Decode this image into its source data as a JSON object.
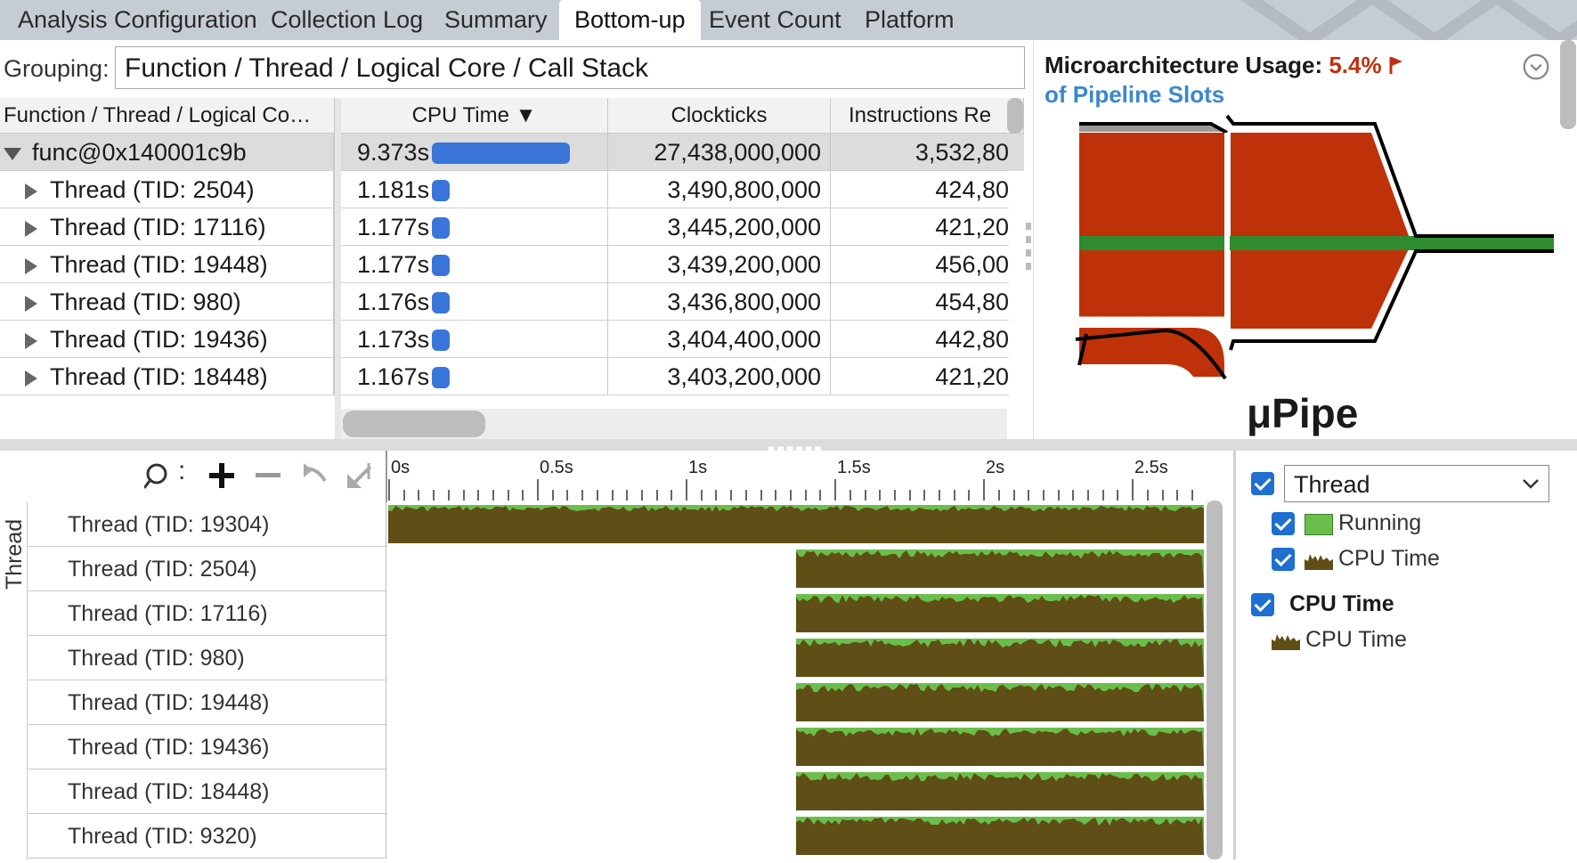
{
  "tabs": [
    {
      "label": "Analysis Configuration",
      "active": false
    },
    {
      "label": "Collection Log",
      "active": false
    },
    {
      "label": "Summary",
      "active": false
    },
    {
      "label": "Bottom-up",
      "active": true
    },
    {
      "label": "Event Count",
      "active": false
    },
    {
      "label": "Platform",
      "active": false
    }
  ],
  "grouping": {
    "label": "Grouping:",
    "value": "Function / Thread / Logical Core / Call Stack"
  },
  "grid": {
    "columns": [
      "Function / Thread / Logical Co…",
      "CPU Time ▼",
      "Clockticks",
      "Instructions Re"
    ],
    "max_cpu_time": 9.373,
    "rows": [
      {
        "name": "func@0x140001c9b",
        "cpu": "9.373s",
        "cpu_s": 9.373,
        "clockticks": "27,438,000,000",
        "instructions": "3,532,80",
        "level": 0,
        "expanded": true
      },
      {
        "name": "Thread (TID: 2504)",
        "cpu": "1.181s",
        "cpu_s": 1.181,
        "clockticks": "3,490,800,000",
        "instructions": "424,80",
        "level": 1,
        "expanded": false
      },
      {
        "name": "Thread (TID: 17116)",
        "cpu": "1.177s",
        "cpu_s": 1.177,
        "clockticks": "3,445,200,000",
        "instructions": "421,20",
        "level": 1,
        "expanded": false
      },
      {
        "name": "Thread (TID: 19448)",
        "cpu": "1.177s",
        "cpu_s": 1.177,
        "clockticks": "3,439,200,000",
        "instructions": "456,00",
        "level": 1,
        "expanded": false
      },
      {
        "name": "Thread (TID: 980)",
        "cpu": "1.176s",
        "cpu_s": 1.176,
        "clockticks": "3,436,800,000",
        "instructions": "454,80",
        "level": 1,
        "expanded": false
      },
      {
        "name": "Thread (TID: 19436)",
        "cpu": "1.173s",
        "cpu_s": 1.173,
        "clockticks": "3,404,400,000",
        "instructions": "442,80",
        "level": 1,
        "expanded": false
      },
      {
        "name": "Thread (TID: 18448)",
        "cpu": "1.167s",
        "cpu_s": 1.167,
        "clockticks": "3,403,200,000",
        "instructions": "421,20",
        "level": 1,
        "expanded": false
      }
    ]
  },
  "uarch": {
    "title": "Microarchitecture Usage:",
    "value": "5.4%",
    "subtitle": "of Pipeline Slots",
    "diagram_label": "μPipe",
    "colors": {
      "stall": "#bf3108",
      "retire": "#2e8b2e",
      "frontend": "#999999"
    }
  },
  "timeline": {
    "axis_label": "Thread",
    "ticks": [
      "0s",
      "0.5s",
      "1s",
      "1.5s",
      "2s",
      "2.5s"
    ],
    "axis_max_s": 2.73,
    "rows": [
      {
        "label": "Thread (TID: 19304)",
        "start_s": 0.0
      },
      {
        "label": "Thread (TID: 2504)",
        "start_s": 1.37
      },
      {
        "label": "Thread (TID: 17116)",
        "start_s": 1.37
      },
      {
        "label": "Thread (TID: 980)",
        "start_s": 1.37
      },
      {
        "label": "Thread (TID: 19448)",
        "start_s": 1.37
      },
      {
        "label": "Thread (TID: 19436)",
        "start_s": 1.37
      },
      {
        "label": "Thread (TID: 18448)",
        "start_s": 1.37
      },
      {
        "label": "Thread (TID: 9320)",
        "start_s": 1.37
      }
    ],
    "colors": {
      "cpu": "#5f4e16",
      "running": "#6abf4b"
    }
  },
  "legend": {
    "select_value": "Thread",
    "group1_items": [
      {
        "label": "Running",
        "swatch": "running"
      },
      {
        "label": "CPU Time",
        "swatch": "cpu"
      }
    ],
    "group2_title": "CPU Time",
    "group2_item": "CPU Time"
  }
}
